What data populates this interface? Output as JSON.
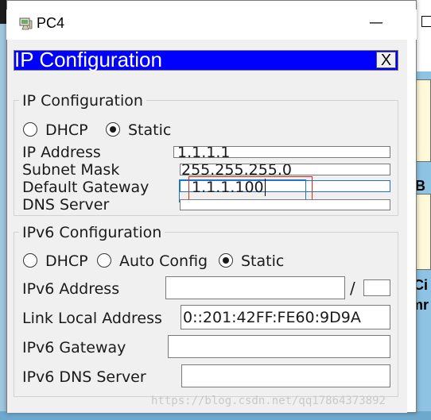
{
  "window": {
    "title": "PC4",
    "minimize_glyph": "—"
  },
  "panel": {
    "title": "IP Configuration",
    "close_label": "X"
  },
  "ipv4": {
    "legend": "IP Configuration",
    "dhcp_label": "DHCP",
    "static_label": "Static",
    "selected_mode": "Static",
    "fields": {
      "ip_address": {
        "label": "IP Address",
        "value": "1.1.1.1"
      },
      "subnet_mask": {
        "label": "Subnet Mask",
        "value": "255.255.255.0"
      },
      "default_gateway": {
        "label": "Default Gateway",
        "value": "1.1.1.100"
      },
      "dns_server": {
        "label": "DNS Server",
        "value": ""
      }
    }
  },
  "ipv6": {
    "legend": "IPv6 Configuration",
    "dhcp_label": "DHCP",
    "auto_label": "Auto Config",
    "static_label": "Static",
    "selected_mode": "Static",
    "fields": {
      "ipv6_address": {
        "label": "IPv6 Address",
        "value": "",
        "prefix": ""
      },
      "link_local": {
        "label": "Link Local Address",
        "value": "0::201:42FF:FE60:9D9A"
      },
      "ipv6_gateway": {
        "label": "IPv6 Gateway",
        "value": ""
      },
      "ipv6_dns": {
        "label": "IPv6 DNS Server",
        "value": ""
      }
    },
    "prefix_separator": "/"
  },
  "background": {
    "right_text_1": "B",
    "right_text_2": "Ci",
    "right_text_3": "mr"
  },
  "watermark": "https://blog.csdn.net/qq17864373892",
  "colors": {
    "header_bar": "#0000ff",
    "focus_border": "#1e74c8",
    "highlight_box": "#e0261b"
  }
}
